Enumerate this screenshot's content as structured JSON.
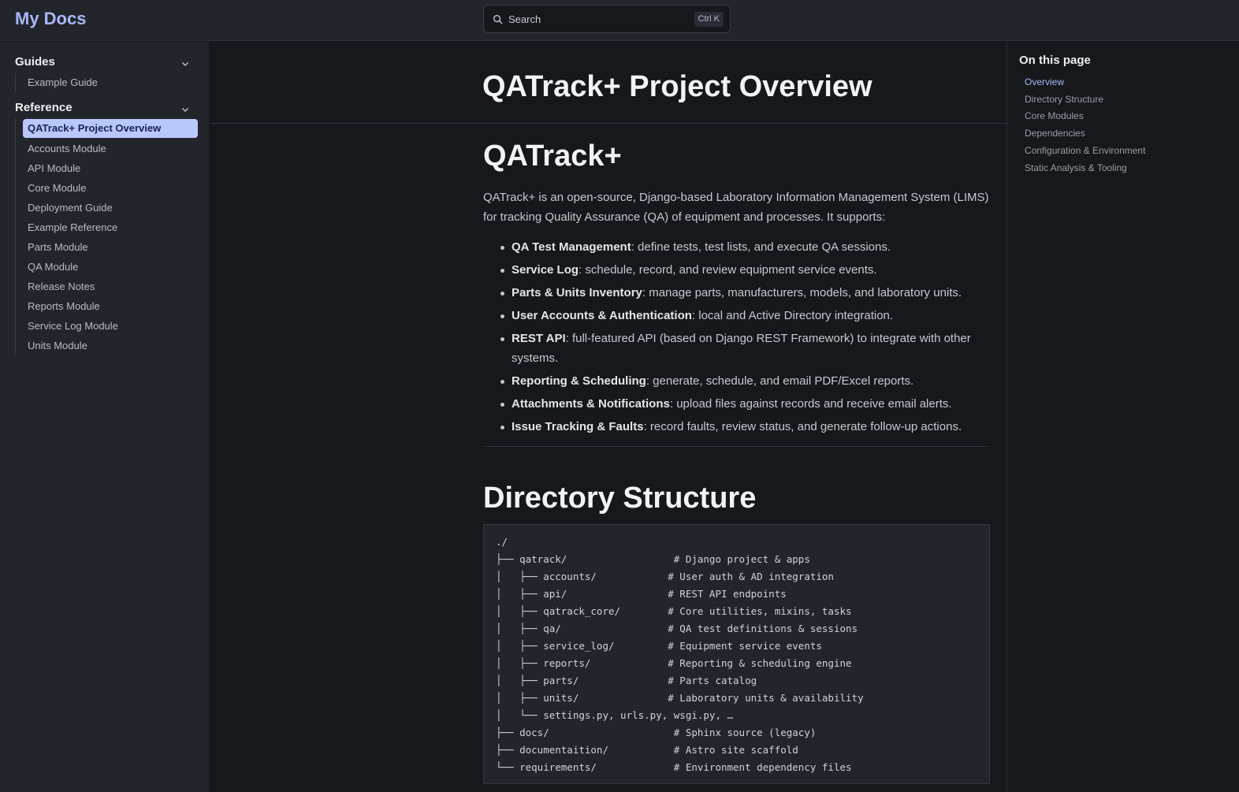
{
  "header": {
    "site_title": "My Docs",
    "search_label": "Search",
    "search_shortcut": "Ctrl K"
  },
  "sidebar": {
    "groups": [
      {
        "title": "Guides",
        "items": [
          "Example Guide"
        ]
      },
      {
        "title": "Reference",
        "items": [
          "QATrack+ Project Overview",
          "Accounts Module",
          "API Module",
          "Core Module",
          "Deployment Guide",
          "Example Reference",
          "Parts Module",
          "QA Module",
          "Release Notes",
          "Reports Module",
          "Service Log Module",
          "Units Module"
        ]
      }
    ],
    "active_item": "QATrack+ Project Overview"
  },
  "main": {
    "page_title": "QATrack+ Project Overview",
    "section1_heading": "QATrack+",
    "intro": "QATrack+ is an open-source, Django-based Laboratory Information Management System (LIMS) for tracking Quality Assurance (QA) of equipment and processes. It supports:",
    "features": [
      {
        "term": "QA Test Management",
        "desc": ": define tests, test lists, and execute QA sessions."
      },
      {
        "term": "Service Log",
        "desc": ": schedule, record, and review equipment service events."
      },
      {
        "term": "Parts & Units Inventory",
        "desc": ": manage parts, manufacturers, models, and laboratory units."
      },
      {
        "term": "User Accounts & Authentication",
        "desc": ": local and Active Directory integration."
      },
      {
        "term": "REST API",
        "desc": ": full-featured API (based on Django REST Framework) to integrate with other systems."
      },
      {
        "term": "Reporting & Scheduling",
        "desc": ": generate, schedule, and email PDF/Excel reports."
      },
      {
        "term": "Attachments & Notifications",
        "desc": ": upload files against records and receive email alerts."
      },
      {
        "term": "Issue Tracking & Faults",
        "desc": ": record faults, review status, and generate follow-up actions."
      }
    ],
    "section2_heading": "Directory Structure",
    "code_lines": [
      "./",
      "├── qatrack/                  # Django project & apps",
      "│   ├── accounts/            # User auth & AD integration",
      "│   ├── api/                 # REST API endpoints",
      "│   ├── qatrack_core/        # Core utilities, mixins, tasks",
      "│   ├── qa/                  # QA test definitions & sessions",
      "│   ├── service_log/         # Equipment service events",
      "│   ├── reports/             # Reporting & scheduling engine",
      "│   ├── parts/               # Parts catalog",
      "│   ├── units/               # Laboratory units & availability",
      "│   └── settings.py, urls.py, wsgi.py, …",
      "├── docs/                     # Sphinx source (legacy)",
      "├── documentaition/           # Astro site scaffold",
      "└── requirements/             # Environment dependency files"
    ]
  },
  "toc": {
    "title": "On this page",
    "items": [
      "Overview",
      "Directory Structure",
      "Core Modules",
      "Dependencies",
      "Configuration & Environment",
      "Static Analysis & Tooling"
    ]
  },
  "colors": {
    "accent": "#a8b8f6",
    "active_bg": "#b9c8fb",
    "background": "#17181c",
    "panel": "#23252d"
  }
}
